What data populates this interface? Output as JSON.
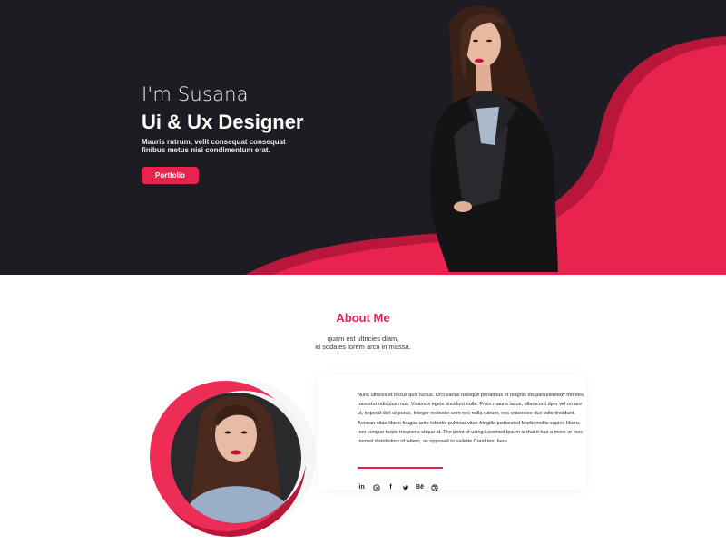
{
  "hero": {
    "greeting": "I'm Susana",
    "role": "Ui & Ux Designer",
    "subtitle_line1": "Mauris rutrum, velit consequat consequat",
    "subtitle_line2": "finibus metus nisi condimentum erat.",
    "button_label": "Portfolio"
  },
  "about": {
    "title": "About Me",
    "sub_line1": "quam est ultricies diam,",
    "sub_line2": "id sodales lorem arcu in massa.",
    "body": "Nunc ultrices et lectus quis luctus. Orci varius natoque penatibus et magnis dis parturientedy montes, nascetur ridiculus mus. Vivamus egete tincidunt nulla. Proin mauris lacus, ullamcord dper vel ornare ut, impedd diet ut purus. Integer molestie sem nec nulla rutrum, nec euismose due odio tincidunt. Aenean vitae libero feugiat ante lobortis pulvinar vitae fringilla justoested Morbi mollis sapien libero, non congue turpis trsapiens stique id. The point of using Loremed Ipsum is that it has a more-or-less normal distribution of letters, as opposed to usilette Cond tent here.",
    "social": [
      {
        "label": "in",
        "icon": "linkedin-icon"
      },
      {
        "label": "S",
        "icon": "skype-icon"
      },
      {
        "label": "f",
        "icon": "facebook-icon"
      },
      {
        "label": "",
        "icon": "twitter-icon"
      },
      {
        "label": "Bē",
        "icon": "behance-icon"
      },
      {
        "label": "",
        "icon": "dribbble-icon"
      }
    ]
  },
  "colors": {
    "accent": "#e8244e",
    "accent_dark": "#b8163a",
    "hero_bg": "#1c1c22"
  }
}
